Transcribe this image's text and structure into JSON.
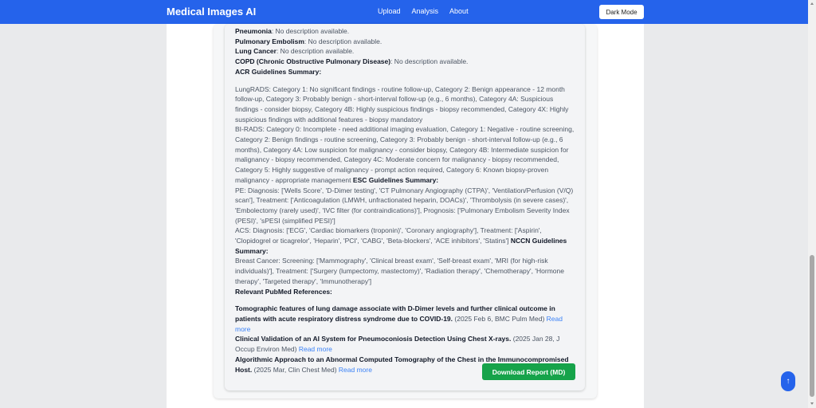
{
  "navbar": {
    "brand": "Medical Images AI",
    "links": [
      "Upload",
      "Analysis",
      "About"
    ],
    "dark_mode_label": "Dark Mode"
  },
  "conditions": [
    {
      "name": "Pneumonia",
      "desc": ": No description available."
    },
    {
      "name": "Pulmonary Embolism",
      "desc": ": No description available."
    },
    {
      "name": "Lung Cancer",
      "desc": ": No description available."
    },
    {
      "name": "COPD (Chronic Obstructive Pulmonary Disease)",
      "desc": ": No description available."
    }
  ],
  "acr_heading": "ACR Guidelines Summary:",
  "lungrads": "LungRADS: Category 1: No significant findings - routine follow-up, Category 2: Benign appearance - 12 month follow-up, Category 3: Probably benign - short-interval follow-up (e.g., 6 months), Category 4A: Suspicious findings - consider biopsy, Category 4B: Highly suspicious findings - biopsy recommended, Category 4X: Highly suspicious findings with additional features - biopsy mandatory",
  "birads": "BI-RADS: Category 0: Incomplete - need additional imaging evaluation, Category 1: Negative - routine screening, Category 2: Benign findings - routine screening, Category 3: Probably benign - short-interval follow-up (e.g., 6 months), Category 4A: Low suspicion for malignancy - consider biopsy, Category 4B: Intermediate suspicion for malignancy - biopsy recommended, Category 4C: Moderate concern for malignancy - biopsy recommended, Category 5: Highly suggestive of malignancy - prompt action required, Category 6: Known biopsy-proven malignancy - appropriate management",
  "esc_heading": "ESC Guidelines Summary:",
  "pe": "PE: Diagnosis: ['Wells Score', 'D-Dimer testing', 'CT Pulmonary Angiography (CTPA)', 'Ventilation/Perfusion (V/Q) scan'], Treatment: ['Anticoagulation (LMWH, unfractionated heparin, DOACs)', 'Thrombolysis (in severe cases)', 'Embolectomy (rarely used)', 'IVC filter (for contraindications)'], Prognosis: ['Pulmonary Embolism Severity Index (PESI)', 'sPESI (simplified PESI)']",
  "acs": "ACS: Diagnosis: ['ECG', 'Cardiac biomarkers (troponin)', 'Coronary angiography'], Treatment: ['Aspirin', 'Clopidogrel or ticagrelor', 'Heparin', 'PCI', 'CABG', 'Beta-blockers', 'ACE inhibitors', 'Statins']",
  "nccn_heading": "NCCN Guidelines Summary:",
  "breast": "Breast Cancer: Screening: ['Mammography', 'Clinical breast exam', 'Self-breast exam', 'MRI (for high-risk individuals)'], Treatment: ['Surgery (lumpectomy, mastectomy)', 'Radiation therapy', 'Chemotherapy', 'Hormone therapy', 'Targeted therapy', 'Immunotherapy']",
  "pubmed_heading": "Relevant PubMed References:",
  "references": [
    {
      "title": "Tomographic features of lung damage associate with D-Dimer levels and further clinical outcome in patients with acute respiratory distress syndrome due to COVID-19.",
      "meta": " (2025 Feb 6, BMC Pulm Med) ",
      "link": "Read more"
    },
    {
      "title": "Clinical Validation of an AI System for Pneumoconiosis Detection Using Chest X-rays.",
      "meta": " (2025 Jan 28, J Occup Environ Med) ",
      "link": "Read more"
    },
    {
      "title": "Algorithmic Approach to an Abnormal Computed Tomography of the Chest in the Immunocompromised Host.",
      "meta": " (2025 Mar, Clin Chest Med) ",
      "link": "Read more"
    }
  ],
  "download_label": "Download Report (MD)",
  "scroll_top_label": "↑",
  "colors": {
    "primary": "#2563eb",
    "download": "#16a34a",
    "link": "#3b82f6"
  }
}
